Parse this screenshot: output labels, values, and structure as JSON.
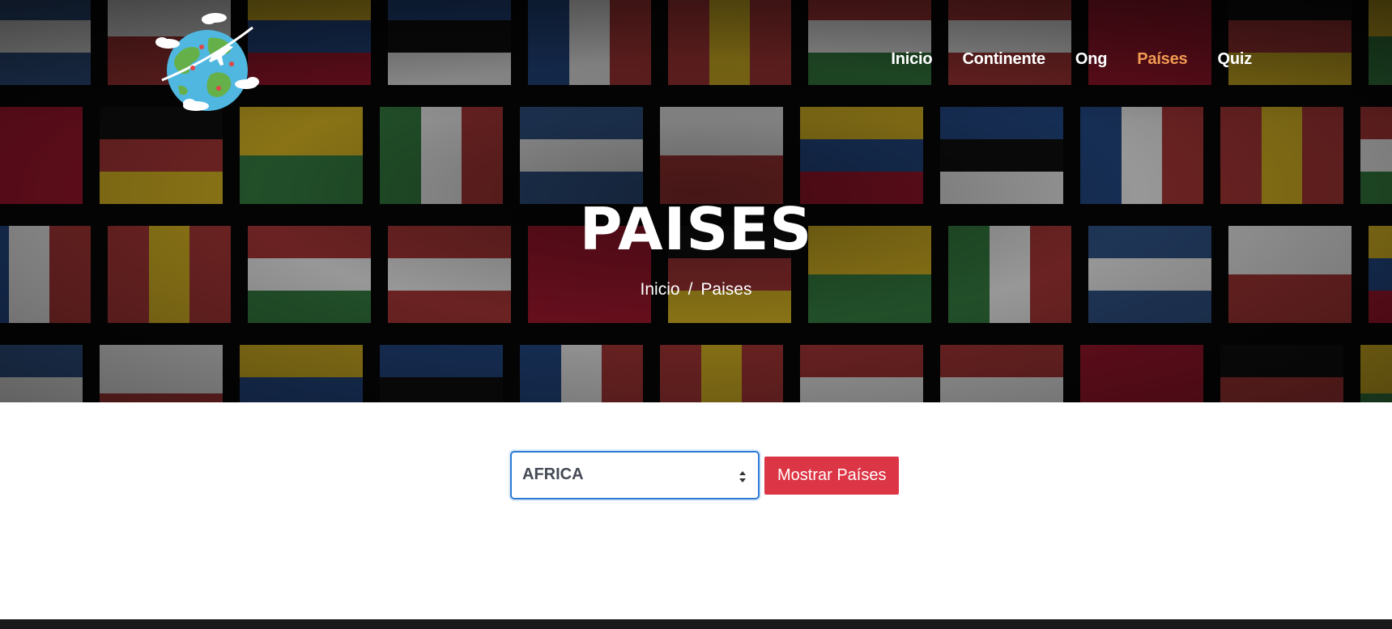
{
  "nav": {
    "items": [
      {
        "label": "Inicio",
        "active": false
      },
      {
        "label": "Continente",
        "active": false
      },
      {
        "label": "Ong",
        "active": false
      },
      {
        "label": "Países",
        "active": true
      },
      {
        "label": "Quiz",
        "active": false
      }
    ]
  },
  "hero": {
    "title": "PAISES",
    "breadcrumb": {
      "home": "Inicio",
      "separator": "/",
      "current": "Paises"
    }
  },
  "form": {
    "continent_select": {
      "value": "AFRICA"
    },
    "submit_label": "Mostrar Países"
  },
  "colors": {
    "accent_nav": "#f29a52",
    "button": "#dc3545",
    "select_focus": "#2b7bd6",
    "footer": "#1a1a1a"
  },
  "icons": {
    "logo": "globe-airplane-logo",
    "select": "updown-arrows-icon"
  }
}
